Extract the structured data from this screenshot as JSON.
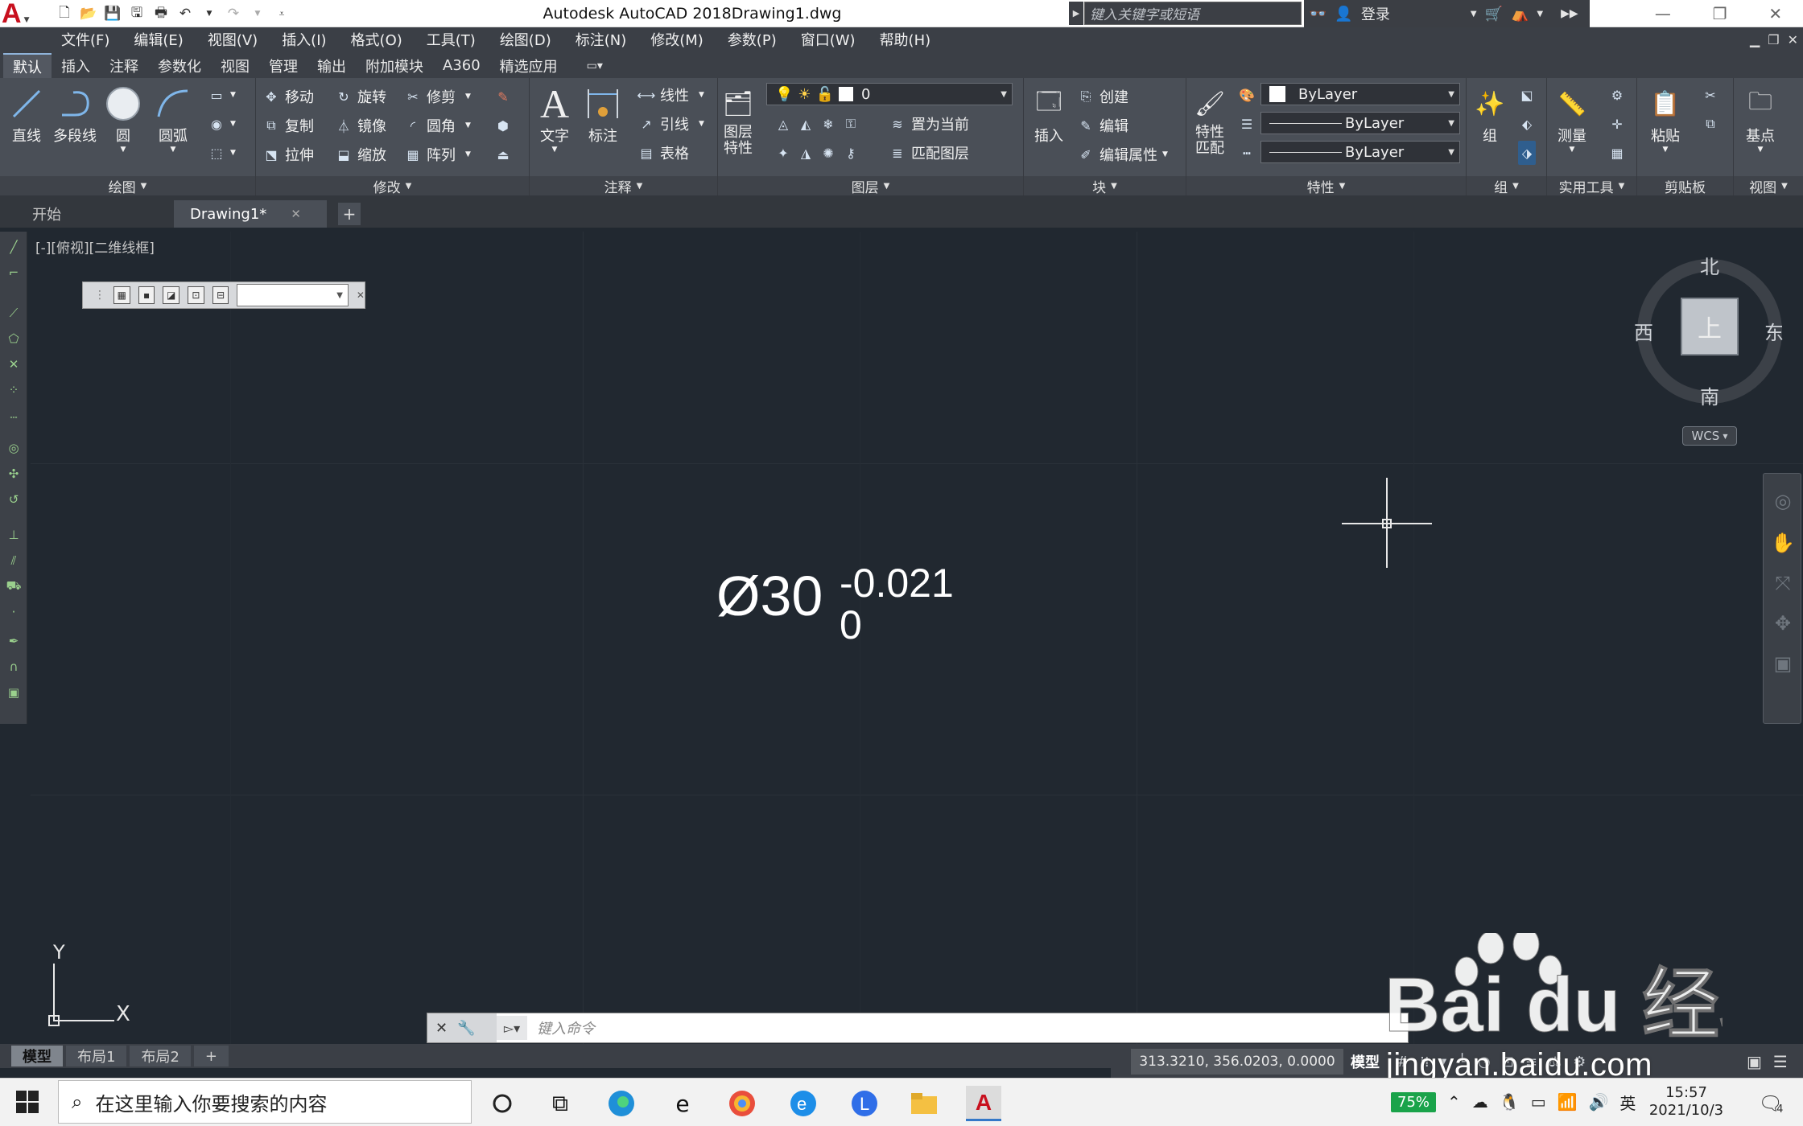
{
  "window": {
    "app_title": "Autodesk AutoCAD 2018",
    "doc_title": "Drawing1.dwg"
  },
  "search": {
    "placeholder": "键入关键字或短语"
  },
  "titlebar_right": {
    "login": "登录"
  },
  "menu": [
    "文件(F)",
    "编辑(E)",
    "视图(V)",
    "插入(I)",
    "格式(O)",
    "工具(T)",
    "绘图(D)",
    "标注(N)",
    "修改(M)",
    "参数(P)",
    "窗口(W)",
    "帮助(H)"
  ],
  "ribbon_tabs": [
    "默认",
    "插入",
    "注释",
    "参数化",
    "视图",
    "管理",
    "输出",
    "附加模块",
    "A360",
    "精选应用"
  ],
  "ribbon": {
    "draw": {
      "title": "绘图",
      "line": "直线",
      "polyline": "多段线",
      "circle": "圆",
      "arc": "圆弧"
    },
    "modify": {
      "title": "修改",
      "move": "移动",
      "rotate": "旋转",
      "trim": "修剪",
      "copy": "复制",
      "mirror": "镜像",
      "fillet": "圆角",
      "stretch": "拉伸",
      "scale": "缩放",
      "array": "阵列"
    },
    "annotation": {
      "title": "注释",
      "text": "文字",
      "dimension": "标注",
      "linear": "线性",
      "leader": "引线",
      "table": "表格"
    },
    "layers": {
      "title": "图层",
      "layer_props_1": "图层",
      "layer_props_2": "特性",
      "current_layer": "0",
      "set_current": "置为当前",
      "match_layer": "匹配图层"
    },
    "block": {
      "title": "块",
      "insert": "插入",
      "create": "创建",
      "edit": "编辑",
      "edit_attributes": "编辑属性"
    },
    "properties": {
      "title": "特性",
      "match_1": "特性",
      "match_2": "匹配",
      "color": "ByLayer",
      "linetype": "ByLayer",
      "lineweight": "ByLayer"
    },
    "groups": {
      "title": "组",
      "group": "组"
    },
    "utilities": {
      "title": "实用工具",
      "measure": "测量"
    },
    "clipboard": {
      "title": "剪贴板",
      "paste": "粘贴"
    },
    "view": {
      "title": "视图",
      "base": "基点"
    }
  },
  "file_tabs": [
    {
      "label": "开始"
    },
    {
      "label": "Drawing1*"
    }
  ],
  "viewport": {
    "label": "[-][俯视][二维线框]"
  },
  "drawing": {
    "diameter_text": "Ø30",
    "upper_tolerance": "-0.021",
    "lower_tolerance": "0"
  },
  "viewcube": {
    "north": "北",
    "south": "南",
    "east": "东",
    "west": "西",
    "top_face": "上",
    "wcs": "WCS"
  },
  "ucs": {
    "x": "X",
    "y": "Y"
  },
  "command_line": {
    "placeholder": "键入命令"
  },
  "layout_tabs": [
    "模型",
    "布局1",
    "布局2"
  ],
  "status": {
    "coordinates": "313.3210, 356.0203, 0.0000",
    "model": "模型"
  },
  "taskbar": {
    "search_placeholder": "在这里输入你要搜索的内容",
    "battery": "75%",
    "ime": "英",
    "time": "15:57",
    "date": "2021/10/3",
    "notifications": "4"
  },
  "watermark": {
    "brand": "Bai du 经验",
    "url": "jingyan.baidu.com"
  },
  "colors": {
    "canvas": "#212830",
    "ribbon": "#4a4f57",
    "menubar": "#3b3f46",
    "autocad_red": "#c8101e"
  }
}
